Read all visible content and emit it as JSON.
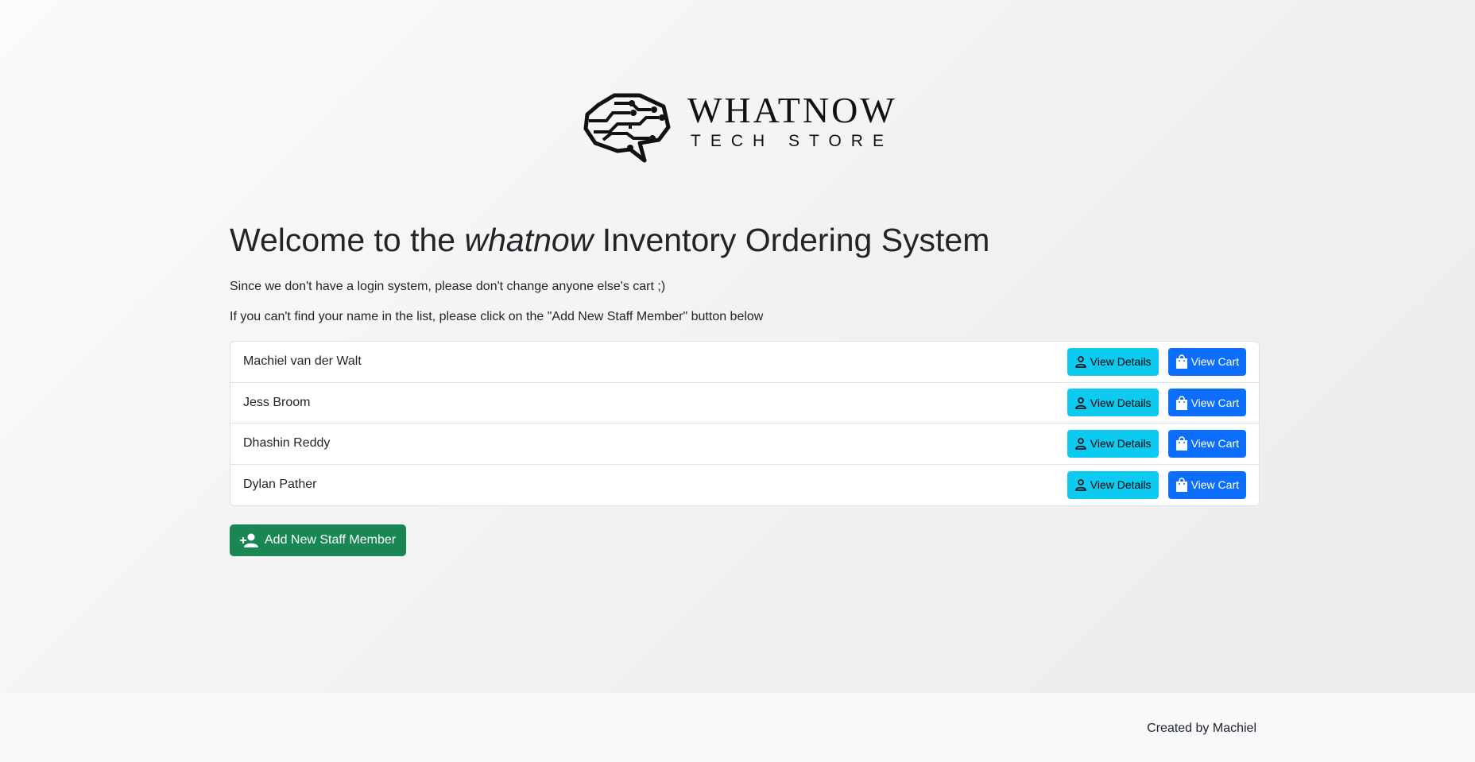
{
  "brand": {
    "title": "WHATNOW",
    "subtitle": "TECH STORE",
    "logo_icon": "brain-circuit-icon"
  },
  "heading": {
    "prefix": "Welcome to the",
    "emphasis": "whatnow",
    "suffix": "Inventory Ordering System"
  },
  "intro": {
    "line1": "Since we don't have a login system, please don't change anyone else's cart ;)",
    "line2": "If you can't find your name in the list, please click on the \"Add New Staff Member\" button below"
  },
  "staff": [
    {
      "name": "Machiel van der Walt",
      "details_label": "View Details",
      "cart_label": "View Cart"
    },
    {
      "name": "Jess Broom",
      "details_label": "View Details",
      "cart_label": "View Cart"
    },
    {
      "name": "Dhashin Reddy",
      "details_label": "View Details",
      "cart_label": "View Cart"
    },
    {
      "name": "Dylan Pather",
      "details_label": "View Details",
      "cart_label": "View Cart"
    }
  ],
  "actions": {
    "add_staff_label": "Add New Staff Member"
  },
  "footer": {
    "credit": "Created by Machiel"
  },
  "colors": {
    "info": "#0dcaf0",
    "primary": "#0d6efd",
    "success": "#198754"
  }
}
